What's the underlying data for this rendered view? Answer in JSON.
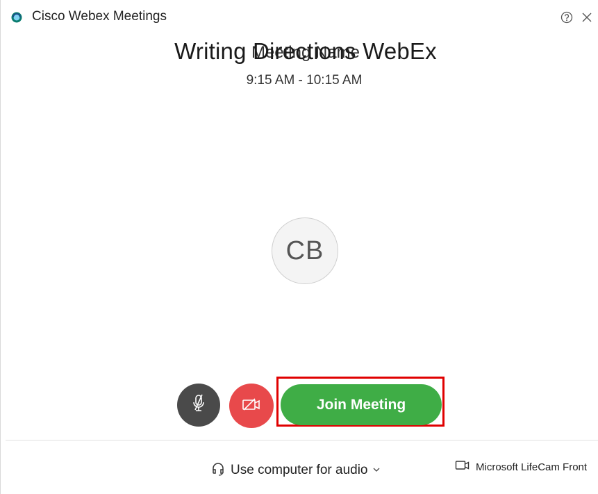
{
  "window": {
    "app_title": "Cisco Webex Meetings",
    "logo_icon": "webex-logo-icon",
    "help_icon": "help-icon",
    "close_icon": "close-icon"
  },
  "meeting": {
    "title": "Writing Directions WebEx",
    "name_overlay": "Meeting Name",
    "time": "9:15 AM - 10:15 AM"
  },
  "avatar": {
    "initials": "CB"
  },
  "controls": {
    "mute_icon": "microphone-muted-icon",
    "video_icon": "video-off-icon",
    "join_label": "Join Meeting",
    "join_color": "#3fad46",
    "video_off_color": "#e8494b",
    "mute_color": "#4a4a4a",
    "highlight_color": "#e00000"
  },
  "footer": {
    "audio_icon": "headset-icon",
    "audio_label": "Use computer for audio",
    "camera_icon": "camera-icon",
    "camera_label": "Microsoft LifeCam Front"
  }
}
